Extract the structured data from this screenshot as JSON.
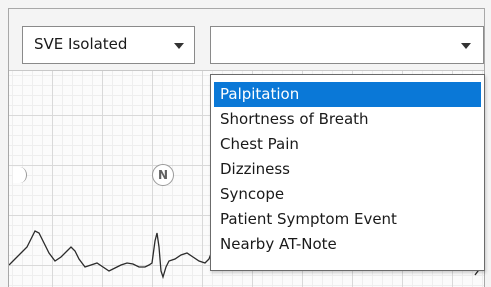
{
  "toolbar": {
    "beat_type_select": {
      "value": "SVE Isolated"
    },
    "symptom_select": {
      "value": ""
    }
  },
  "ecg_view": {
    "beat_marker_label": "N"
  },
  "symptom_dropdown": {
    "options": [
      {
        "label": "Palpitation",
        "selected": true
      },
      {
        "label": "Shortness of Breath",
        "selected": false
      },
      {
        "label": "Chest Pain",
        "selected": false
      },
      {
        "label": "Dizziness",
        "selected": false
      },
      {
        "label": "Syncope",
        "selected": false
      },
      {
        "label": "Patient Symptom Event",
        "selected": false
      },
      {
        "label": "Nearby AT-Note",
        "selected": false
      }
    ]
  },
  "colors": {
    "selection_highlight": "#0a78d7",
    "ecg_trace": "#2b2b2b"
  }
}
